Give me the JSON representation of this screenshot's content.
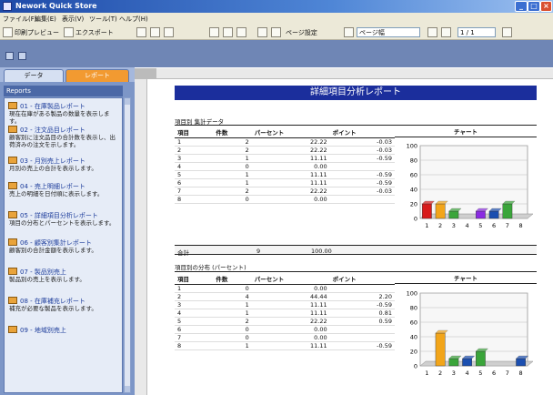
{
  "window": {
    "title": "Nework Quick Store"
  },
  "menu": [
    "ファイル(F)",
    "編集(E)",
    "表示(V)",
    "ツール(T)",
    "ヘルプ(H)"
  ],
  "toolbar": {
    "buttons": [
      "印刷プレビュー",
      "エクスポート"
    ],
    "mid_label": "ページ設定",
    "zoom": "ページ幅",
    "page_indicator": "1 / 1"
  },
  "panel": {
    "tabs": [
      "データ",
      "レポート"
    ],
    "header": "Reports"
  },
  "sidebar_items": [
    {
      "title": "01 - 在庫製品レポート",
      "desc": "現在在庫がある製品の数量を表示します。"
    },
    {
      "title": "02 - 注文品目レポート",
      "desc": "顧客別に注文品目の合計数を表示し、出荷済みの注文を示します。"
    },
    {
      "title": "03 - 月別売上レポート",
      "desc": "月別の売上の合計を表示します。"
    },
    {
      "title": "04 - 売上明細レポート",
      "desc": "売上の明細を日付順に表示します。"
    },
    {
      "title": "05 - 詳細項目分析レポート",
      "desc": "項目の分布とパーセントを表示します。"
    },
    {
      "title": "06 - 顧客別集計レポート",
      "desc": "顧客別の合計金額を表示します。"
    },
    {
      "title": "07 - 製品別売上",
      "desc": "製品別の売上を表示します。"
    },
    {
      "title": "08 - 在庫補充レポート",
      "desc": "補充が必要な製品を表示します。"
    },
    {
      "title": "09 - 地域別売上",
      "desc": ""
    }
  ],
  "report": {
    "title": "詳細項目分析レポート",
    "section1": {
      "caption": "項目別 集計データ",
      "headers": [
        "項目",
        "件数",
        "パーセント",
        "ポイント",
        "チャート"
      ],
      "rows": [
        [
          "1",
          "2",
          "22.22",
          "-0.03"
        ],
        [
          "2",
          "2",
          "22.22",
          "-0.03"
        ],
        [
          "3",
          "1",
          "11.11",
          "-0.59"
        ],
        [
          "4",
          "0",
          "0.00",
          ""
        ],
        [
          "5",
          "1",
          "11.11",
          "-0.59"
        ],
        [
          "6",
          "1",
          "11.11",
          "-0.59"
        ],
        [
          "7",
          "2",
          "22.22",
          "-0.03"
        ],
        [
          "8",
          "0",
          "0.00",
          ""
        ]
      ],
      "summary": [
        "合計",
        "9",
        "100.00"
      ]
    },
    "section2": {
      "caption": "項目別の分布 (パーセント)",
      "headers": [
        "項目",
        "件数",
        "パーセント",
        "ポイント",
        "チャート"
      ],
      "rows": [
        [
          "1",
          "0",
          "0.00",
          ""
        ],
        [
          "2",
          "4",
          "44.44",
          "2.20"
        ],
        [
          "3",
          "1",
          "11.11",
          "-0.59"
        ],
        [
          "4",
          "1",
          "11.11",
          "0.81"
        ],
        [
          "5",
          "2",
          "22.22",
          "0.59"
        ],
        [
          "6",
          "0",
          "0.00",
          ""
        ],
        [
          "7",
          "0",
          "0.00",
          ""
        ],
        [
          "8",
          "1",
          "11.11",
          "-0.59"
        ]
      ]
    }
  },
  "chart_data": [
    {
      "type": "bar",
      "categories": [
        "1",
        "2",
        "3",
        "4",
        "5",
        "6",
        "7",
        "8"
      ],
      "values": [
        20,
        20,
        10,
        0,
        10,
        10,
        20,
        0
      ],
      "ylim": [
        0,
        100
      ],
      "yticks": [
        0,
        20,
        40,
        60,
        80,
        100
      ],
      "colors": [
        "#d81b1b",
        "#f2a51a",
        "#3aa53a",
        "#1b4fb0",
        "#8a2be2",
        "#1b4fb0",
        "#3aa53a",
        "#d81b1b"
      ]
    },
    {
      "type": "bar",
      "categories": [
        "1",
        "2",
        "3",
        "4",
        "5",
        "6",
        "7",
        "8"
      ],
      "values": [
        0,
        45,
        10,
        10,
        20,
        0,
        0,
        10
      ],
      "ylim": [
        0,
        100
      ],
      "yticks": [
        0,
        20,
        40,
        60,
        80,
        100
      ],
      "colors": [
        "#d81b1b",
        "#f2a51a",
        "#3aa53a",
        "#1b4fb0",
        "#3aa53a",
        "#d81b1b",
        "#f2a51a",
        "#1b4fb0"
      ]
    }
  ]
}
